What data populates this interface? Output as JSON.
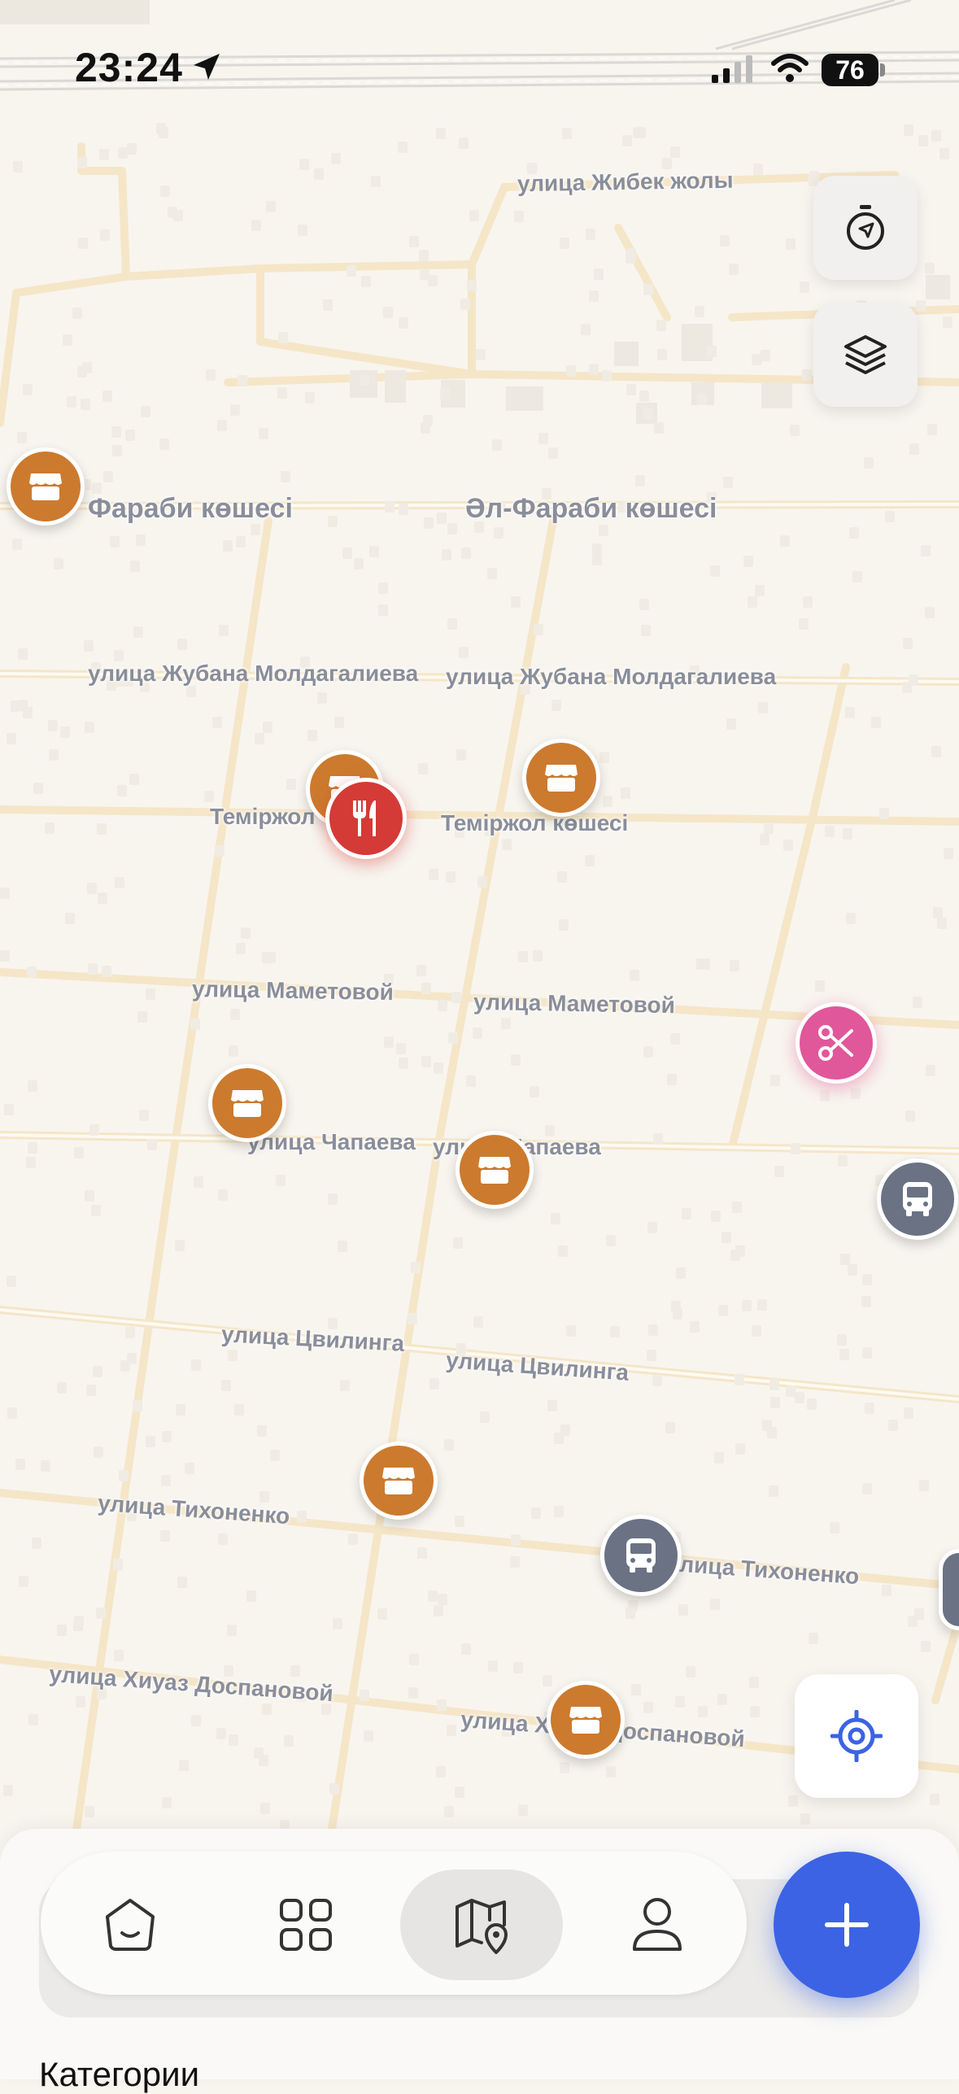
{
  "status_bar": {
    "time": "23:24",
    "battery": "76"
  },
  "streets": [
    {
      "id": "zhibek-zholy",
      "name": "улица Жибек жолы"
    },
    {
      "id": "al-farabi-left",
      "name": "Фараби көшесі"
    },
    {
      "id": "al-farabi",
      "name": "Әл-Фараби көшесі"
    },
    {
      "id": "zhubana-left",
      "name": "улица Жубана Молдагалиева"
    },
    {
      "id": "zhubana-right",
      "name": "улица Жубана Молдагалиева"
    },
    {
      "id": "temirzhol-left",
      "name": "Теміржол"
    },
    {
      "id": "temirzhol-right",
      "name": "Теміржол көшесі"
    },
    {
      "id": "mametovoy-left",
      "name": "улица Маметовой"
    },
    {
      "id": "mametovoy-right",
      "name": "улица Маметовой"
    },
    {
      "id": "chapaeva-left",
      "name": "улица Чапаева"
    },
    {
      "id": "chapaeva-right",
      "name": "улица Чапаева"
    },
    {
      "id": "tsvilinga-left",
      "name": "улица Цвилинга"
    },
    {
      "id": "tsvilinga-right",
      "name": "улица Цвилинга"
    },
    {
      "id": "tikhonenko-left",
      "name": "улица Тихоненко"
    },
    {
      "id": "tikhonenko-right",
      "name": "улица Тихоненко"
    },
    {
      "id": "dospanovoy-left",
      "name": "улица Хиуаз Доспановой"
    },
    {
      "id": "dospanovoy-right",
      "name": "улица Хиуаз Доспановой"
    }
  ],
  "pins": [
    {
      "id": "shop-1",
      "category": "shop"
    },
    {
      "id": "shop-2",
      "category": "shop"
    },
    {
      "id": "shop-3",
      "category": "shop"
    },
    {
      "id": "food-1",
      "category": "restaurant"
    },
    {
      "id": "beauty-1",
      "category": "beauty"
    },
    {
      "id": "shop-4",
      "category": "shop"
    },
    {
      "id": "shop-5",
      "category": "shop"
    },
    {
      "id": "bus-1",
      "category": "bus"
    },
    {
      "id": "shop-6",
      "category": "shop"
    },
    {
      "id": "bus-2",
      "category": "bus"
    },
    {
      "id": "shop-7",
      "category": "shop"
    },
    {
      "id": "bus-3",
      "category": "bus"
    }
  ],
  "controls": {
    "compass_icon": "compass-icon",
    "layers_icon": "layers-icon",
    "locate_icon": "locate-icon"
  },
  "tabbar": {
    "tabs": [
      {
        "id": "home",
        "icon": "home-icon"
      },
      {
        "id": "catalog",
        "icon": "grid-icon"
      },
      {
        "id": "map",
        "icon": "map-pin-icon",
        "active": true
      },
      {
        "id": "profile",
        "icon": "profile-icon"
      }
    ],
    "fab_icon": "plus-icon"
  },
  "sheet": {
    "title": "Категории"
  },
  "colors": {
    "shop": "#cc7a2e",
    "restaurant": "#d43a36",
    "beauty": "#e0579a",
    "bus": "#6a7284",
    "accent": "#3b63e4"
  }
}
